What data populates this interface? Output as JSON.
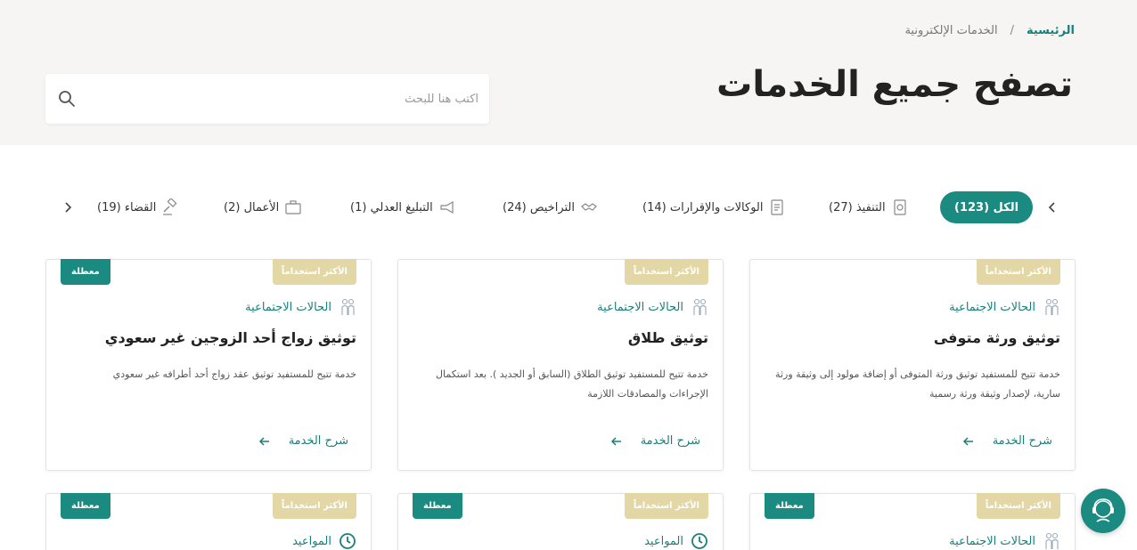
{
  "breadcrumb": {
    "home": "الرئيسية",
    "separator": "/",
    "current": "الخدمات الإلكترونية"
  },
  "page_title": "تصفح جميع الخدمات",
  "search": {
    "placeholder": "اكتب هنا للبحث",
    "value": "",
    "icon": "search-icon"
  },
  "tabs": [
    {
      "label": "الكل (123)",
      "active": true
    },
    {
      "label": "التنفيذ (27)",
      "icon": "execution-icon"
    },
    {
      "label": "الوكالات والإقرارات (14)",
      "icon": "document-icon"
    },
    {
      "label": "التراخيص (24)",
      "icon": "handshake-icon"
    },
    {
      "label": "التبليغ العدلي (1)",
      "icon": "megaphone-icon"
    },
    {
      "label": "الأعمال (2)",
      "icon": "briefcase-icon"
    },
    {
      "label": "القضاء (19)",
      "icon": "gavel-icon"
    }
  ],
  "cards": [
    {
      "popular": "الأكثر استخداماً",
      "disabled": "",
      "category": "الحالات الاجتماعية",
      "category_icon": "family-icon",
      "title": "توثيق ورثة متوفى",
      "description": "خدمة تتيح للمستفيد توثيق ورثة المتوفى أو إضافة مولود إلى وثيقة ورثة سارية، لإصدار وثيقة ورثة رسمية",
      "more": "شرح الخدمة"
    },
    {
      "popular": "الأكثر استخداماً",
      "disabled": "",
      "category": "الحالات الاجتماعية",
      "category_icon": "family-icon",
      "title": "توثيق طلاق",
      "description": "خدمة تتيح للمستفيد توثيق الطلاق (السابق أو الجديد ). بعد استكمال الإجراءات والمصادقات اللازمة",
      "more": "شرح الخدمة"
    },
    {
      "popular": "الأكثر استخداماً",
      "disabled": "معطلة",
      "category": "الحالات الاجتماعية",
      "category_icon": "family-icon",
      "title": "توثيق زواج أحد الزوجين غير سعودي",
      "description": "خدمة تتيح للمستفيد توثيق عقد زواج أحد أطرافه غير سعودي",
      "more": "شرح الخدمة"
    },
    {
      "popular": "الأكثر استخداماً",
      "disabled": "معطلة",
      "category": "الحالات الاجتماعية",
      "category_icon": "family-icon"
    },
    {
      "popular": "الأكثر استخداماً",
      "disabled": "معطلة",
      "category": "المواعيد",
      "category_icon": "clock-icon"
    },
    {
      "popular": "الأكثر استخداماً",
      "disabled": "معطلة",
      "category": "المواعيد",
      "category_icon": "clock-icon"
    }
  ],
  "colors": {
    "accent": "#1b8a80",
    "popular_badge": "#e3d7a6",
    "hero_bg": "#f6f5f3"
  }
}
